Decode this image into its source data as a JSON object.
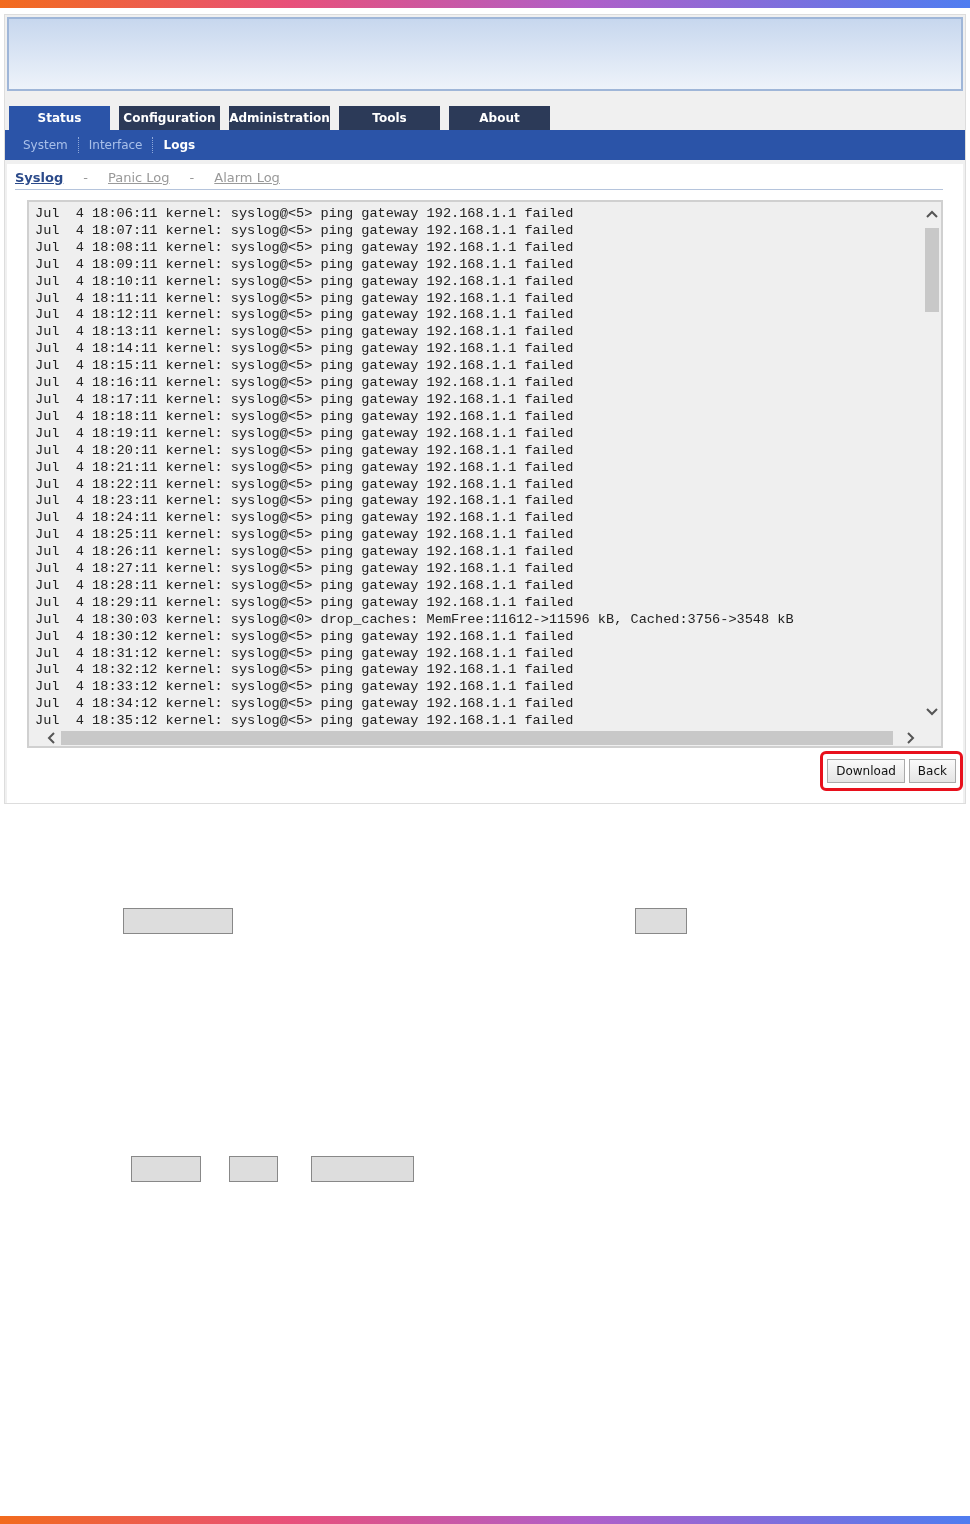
{
  "tabs": [
    {
      "label": "Status",
      "selected": true
    },
    {
      "label": "Configuration",
      "selected": false
    },
    {
      "label": "Administration",
      "selected": false
    },
    {
      "label": "Tools",
      "selected": false
    },
    {
      "label": "About",
      "selected": false
    }
  ],
  "subnav": [
    {
      "label": "System",
      "selected": false
    },
    {
      "label": "Interface",
      "selected": false
    },
    {
      "label": "Logs",
      "selected": true
    }
  ],
  "log_tabs": [
    {
      "label": "Syslog",
      "selected": true
    },
    {
      "label": "Panic Log",
      "selected": false
    },
    {
      "label": "Alarm Log",
      "selected": false
    }
  ],
  "log_separator": "-",
  "log_lines": [
    "Jul  4 18:06:11 kernel: syslog@<5> ping gateway 192.168.1.1 failed",
    "Jul  4 18:07:11 kernel: syslog@<5> ping gateway 192.168.1.1 failed",
    "Jul  4 18:08:11 kernel: syslog@<5> ping gateway 192.168.1.1 failed",
    "Jul  4 18:09:11 kernel: syslog@<5> ping gateway 192.168.1.1 failed",
    "Jul  4 18:10:11 kernel: syslog@<5> ping gateway 192.168.1.1 failed",
    "Jul  4 18:11:11 kernel: syslog@<5> ping gateway 192.168.1.1 failed",
    "Jul  4 18:12:11 kernel: syslog@<5> ping gateway 192.168.1.1 failed",
    "Jul  4 18:13:11 kernel: syslog@<5> ping gateway 192.168.1.1 failed",
    "Jul  4 18:14:11 kernel: syslog@<5> ping gateway 192.168.1.1 failed",
    "Jul  4 18:15:11 kernel: syslog@<5> ping gateway 192.168.1.1 failed",
    "Jul  4 18:16:11 kernel: syslog@<5> ping gateway 192.168.1.1 failed",
    "Jul  4 18:17:11 kernel: syslog@<5> ping gateway 192.168.1.1 failed",
    "Jul  4 18:18:11 kernel: syslog@<5> ping gateway 192.168.1.1 failed",
    "Jul  4 18:19:11 kernel: syslog@<5> ping gateway 192.168.1.1 failed",
    "Jul  4 18:20:11 kernel: syslog@<5> ping gateway 192.168.1.1 failed",
    "Jul  4 18:21:11 kernel: syslog@<5> ping gateway 192.168.1.1 failed",
    "Jul  4 18:22:11 kernel: syslog@<5> ping gateway 192.168.1.1 failed",
    "Jul  4 18:23:11 kernel: syslog@<5> ping gateway 192.168.1.1 failed",
    "Jul  4 18:24:11 kernel: syslog@<5> ping gateway 192.168.1.1 failed",
    "Jul  4 18:25:11 kernel: syslog@<5> ping gateway 192.168.1.1 failed",
    "Jul  4 18:26:11 kernel: syslog@<5> ping gateway 192.168.1.1 failed",
    "Jul  4 18:27:11 kernel: syslog@<5> ping gateway 192.168.1.1 failed",
    "Jul  4 18:28:11 kernel: syslog@<5> ping gateway 192.168.1.1 failed",
    "Jul  4 18:29:11 kernel: syslog@<5> ping gateway 192.168.1.1 failed",
    "Jul  4 18:30:03 kernel: syslog@<0> drop_caches: MemFree:11612->11596 kB, Cached:3756->3548 kB",
    "Jul  4 18:30:12 kernel: syslog@<5> ping gateway 192.168.1.1 failed",
    "Jul  4 18:31:12 kernel: syslog@<5> ping gateway 192.168.1.1 failed",
    "Jul  4 18:32:12 kernel: syslog@<5> ping gateway 192.168.1.1 failed",
    "Jul  4 18:33:12 kernel: syslog@<5> ping gateway 192.168.1.1 failed",
    "Jul  4 18:34:12 kernel: syslog@<5> ping gateway 192.168.1.1 failed",
    "Jul  4 18:35:12 kernel: syslog@<5> ping gateway 192.168.1.1 failed"
  ],
  "buttons": [
    "Download",
    "Back"
  ],
  "buttons_highlighted": true
}
